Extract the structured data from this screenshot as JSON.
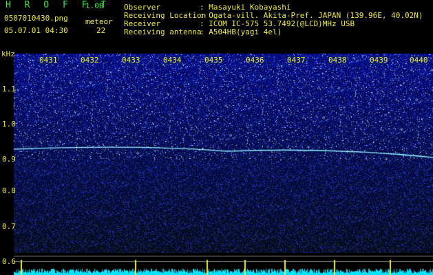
{
  "header": {
    "app_title": "H R O F F T",
    "version": "1.00",
    "filename": "0507010430.png",
    "meteor_label": "meteor",
    "datetime": "05.07.01 04:30",
    "meteor_count": "22"
  },
  "station_info": [
    {
      "key": "Observer",
      "value": ": Masayuki Kobayashi"
    },
    {
      "key": "Receiving Location",
      "value": ": Ogata-vill. Akita-Pref. JAPAN (139.96E, 40.02N)"
    },
    {
      "key": "Receiver",
      "value": ": ICOM IC-575 53.7492(@LCD)MHz USB"
    },
    {
      "key": "Receiving antenna",
      "value": ": A504HB(yagi 4el)"
    }
  ],
  "spectrogram": {
    "unit_label": "kHz",
    "freq_labels": [
      "1.1",
      "1.0",
      "0.9",
      "0.8",
      "0.7",
      "0.6"
    ],
    "time_labels": [
      "0431",
      "0432",
      "0433",
      "0434",
      "0435",
      "0436",
      "0437",
      "0438",
      "0439",
      "0440"
    ],
    "colors": {
      "text": "#f2ec3a",
      "title": "#36e83a",
      "trace": "#8ff0ff",
      "power": "#00e5ff"
    }
  }
}
